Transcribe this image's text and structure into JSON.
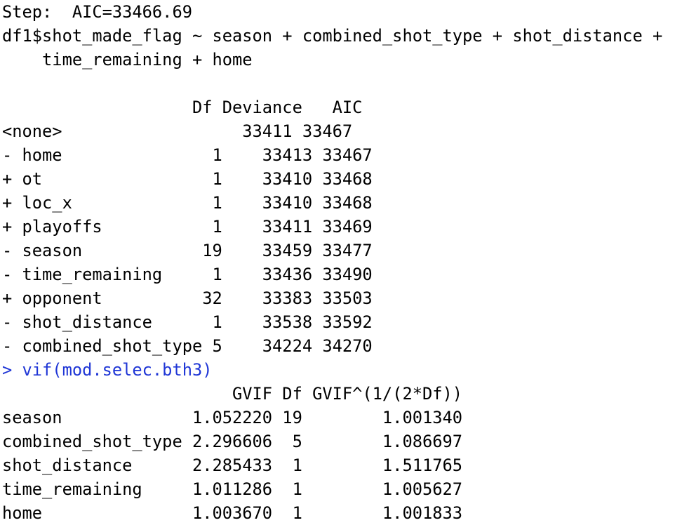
{
  "step": {
    "header": "Step:  AIC=33466.69",
    "formula_line1": "df1$shot_made_flag ~ season + combined_shot_type + shot_distance +",
    "formula_line2": "    time_remaining + home"
  },
  "step_table": {
    "header": "                   Df Deviance   AIC",
    "rows": [
      "<none>                  33411 33467",
      "- home               1    33413 33467",
      "+ ot                 1    33410 33468",
      "+ loc_x              1    33410 33468",
      "+ playoffs           1    33411 33469",
      "- season            19    33459 33477",
      "- time_remaining     1    33436 33490",
      "+ opponent          32    33383 33503",
      "- shot_distance      1    33538 33592",
      "- combined_shot_type 5    34224 34270"
    ]
  },
  "command": {
    "prompt": "> ",
    "text": "vif(mod.selec.bth3)",
    "full": "> vif(mod.selec.bth3)",
    "color": "#1f36d6"
  },
  "vif_table": {
    "header": "                       GVIF Df GVIF^(1/(2*Df))",
    "rows": [
      "season             1.052220 19        1.001340",
      "combined_shot_type 2.296606  5        1.086697",
      "shot_distance      2.285433  1        1.511765",
      "time_remaining     1.011286  1        1.005627",
      "home               1.003670  1        1.001833"
    ]
  }
}
